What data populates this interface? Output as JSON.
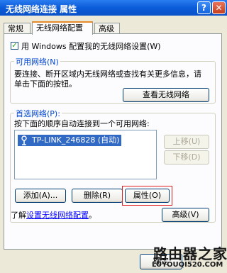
{
  "window": {
    "title": "无线网络连接 属性",
    "help_label": "?",
    "close_label": "✕"
  },
  "tabs": [
    {
      "label": "常规"
    },
    {
      "label": "无线网络配置"
    },
    {
      "label": "高级"
    }
  ],
  "config": {
    "use_windows_label": "用 Windows 配置我的无线网络设置(W)",
    "use_windows_checked": true
  },
  "available": {
    "legend": "可用网络(N)",
    "description_line1": "要连接、断开区域内无线网络或查找有关更多信息，请",
    "description_line2": "单击下面的按钮。",
    "view_button": "查看无线网络"
  },
  "preferred": {
    "legend": "首选网络(P):",
    "description": "按下面的顺序自动连接到一个可用网络:",
    "networks": [
      {
        "name": "TP-LINK_246828",
        "status": "(自动)",
        "display": "TP-LINK_246828 (自动)"
      }
    ],
    "move_up_button": "上移(U)",
    "move_down_button": "下移(D)",
    "add_button": "添加(A)...",
    "remove_button": "删除(R)",
    "properties_button": "属性(O)"
  },
  "learn": {
    "prefix": "了解",
    "link": "设置无线网络配置",
    "suffix": "。",
    "advanced_button": "高级(V)"
  },
  "footer": {
    "ok_button": "确定"
  },
  "watermark": {
    "line1": "路由器之家",
    "line2": "LUYOUQI520.COM"
  },
  "colors": {
    "titlebar": "#0b5bd8",
    "highlight": "#316ac5",
    "legend_text": "#0046d5",
    "emphasis_box": "#e02020"
  }
}
